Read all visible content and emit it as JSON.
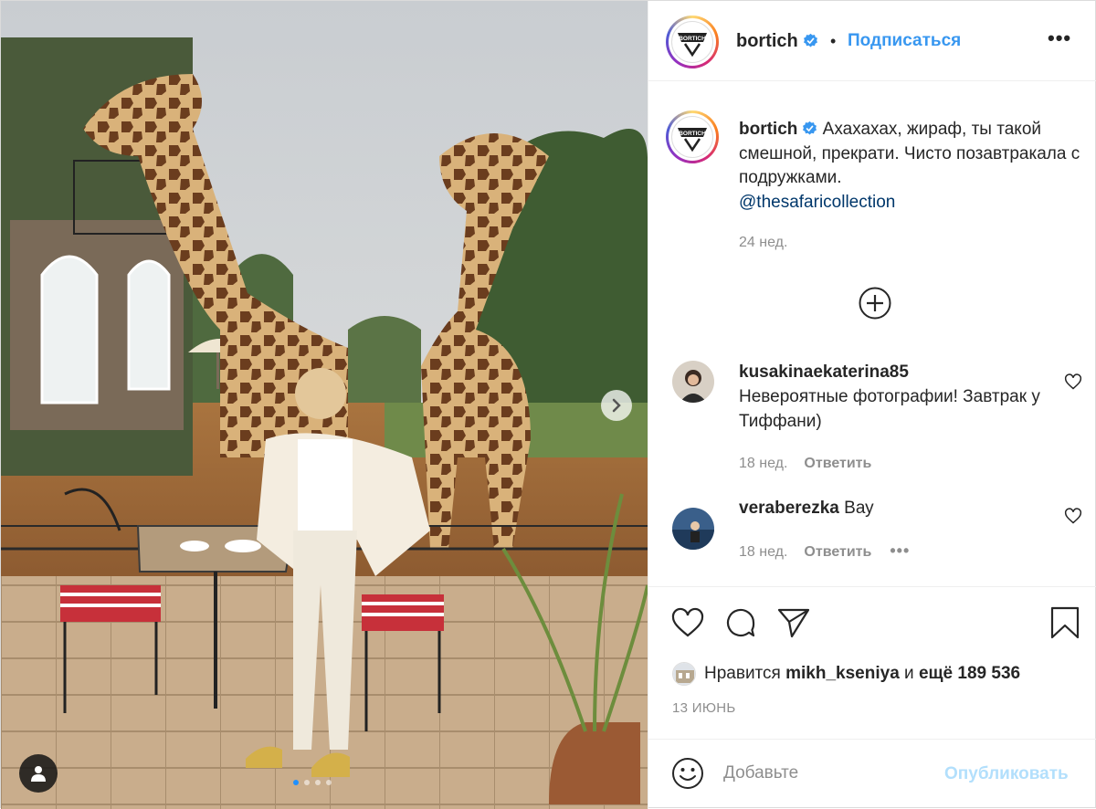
{
  "header": {
    "username": "bortich",
    "separator": "•",
    "follow_label": "Подписаться",
    "more_label": "•••"
  },
  "avatar": {
    "logo_text": "BORTICH"
  },
  "caption": {
    "username": "bortich",
    "text": "Ахахахах, жираф, ты такой смешной, прекрати. Чисто позавтракала с подружками.",
    "mention": "@thesafaricollection",
    "time": "24 нед."
  },
  "comments": [
    {
      "username": "kusakinaekaterina85",
      "text": "Невероятные фотографии! Завтрак у Тиффани)",
      "time": "18 нед.",
      "reply_label": "Ответить"
    },
    {
      "username": "veraberezka",
      "text": "Вау",
      "time": "18 нед.",
      "reply_label": "Ответить",
      "more_label": "•••"
    }
  ],
  "likes": {
    "prefix": "Нравится",
    "user": "mikh_kseniya",
    "middle": "и",
    "others": "ещё 189 536"
  },
  "post_date": "13 ИЮНЬ",
  "comment_box": {
    "placeholder": "Добавьте",
    "publish_label": "Опубликовать"
  },
  "carousel": {
    "slides": 4,
    "active": 1
  },
  "colors": {
    "link": "#3897f0",
    "mention": "#00376b",
    "publish_disabled": "#b2dffc",
    "verified": "#3897f0"
  },
  "icons": [
    "verified-icon",
    "add-comment-icon",
    "heart-icon",
    "comment-icon",
    "share-icon",
    "bookmark-icon",
    "emoji-icon",
    "next-arrow-icon",
    "user-tag-icon"
  ]
}
